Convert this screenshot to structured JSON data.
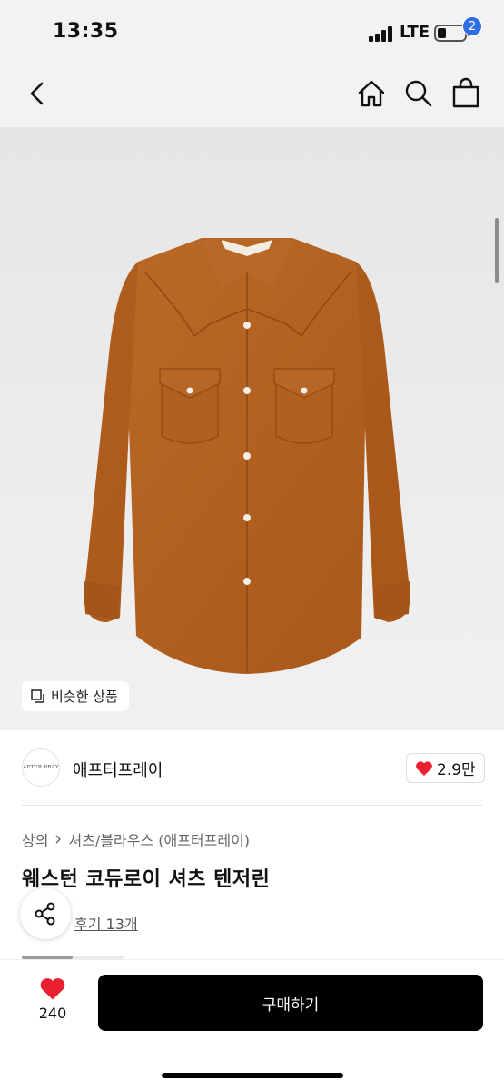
{
  "status": {
    "time": "13:35",
    "network": "LTE"
  },
  "nav": {
    "cart_count": "2",
    "icons": [
      "back-icon",
      "home-icon",
      "search-icon",
      "cart-icon"
    ]
  },
  "hero": {
    "similar_label": "비슷한 상품",
    "label_text": "AFTER PRAY"
  },
  "brand": {
    "logo_text": "AFTER PRAY",
    "name": "애프터프레이",
    "likes": "2.9만"
  },
  "product": {
    "breadcrumb": [
      "상의",
      "셔츠/블라우스 (애프터프레이)"
    ],
    "title": "웨스턴 코듀로이 셔츠 텐저린",
    "review_link": "후기 13개"
  },
  "bottom": {
    "wish_count": "240",
    "buy_label": "구매하기"
  },
  "colors": {
    "accent": "#2f6ee8",
    "heart": "#e8202f",
    "buy_bg": "#000000",
    "shirt": "#b2601f"
  }
}
